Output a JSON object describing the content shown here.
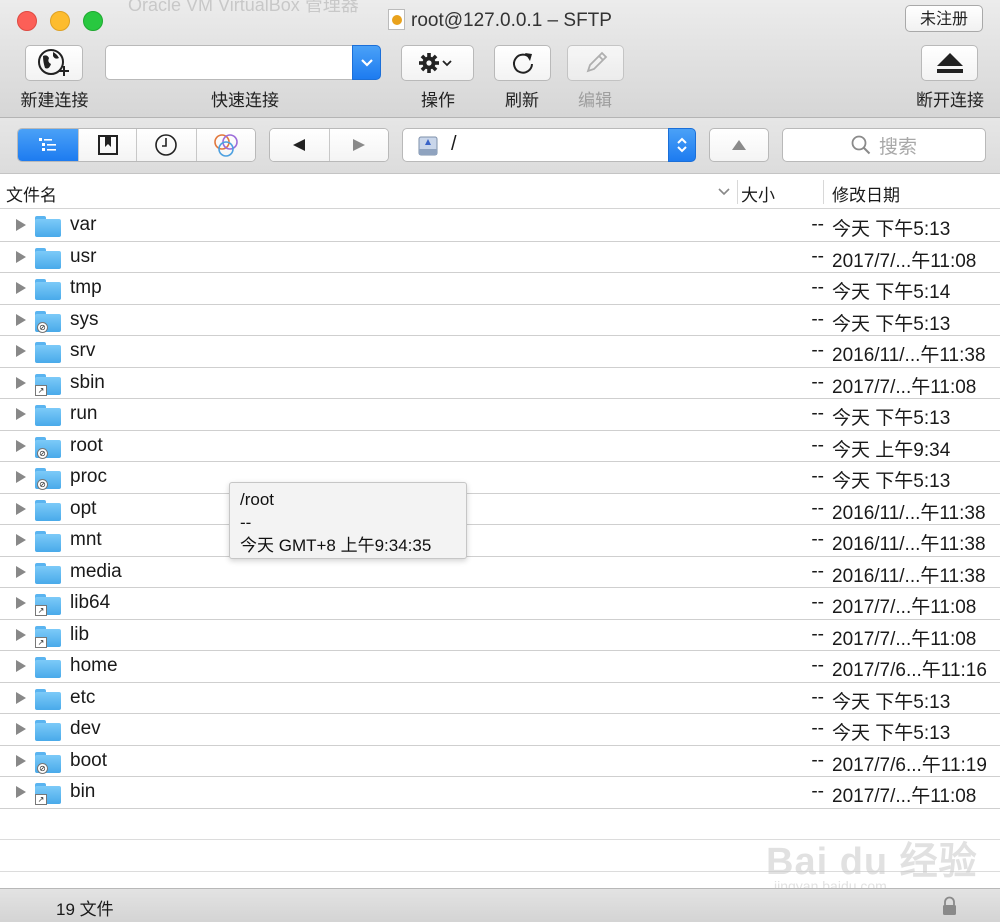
{
  "window": {
    "title": "root@127.0.0.1 – SFTP",
    "background_title": "Oracle VM VirtualBox 管理器",
    "register_label": "未注册"
  },
  "toolbar": {
    "new_connection_label": "新建连接",
    "quick_connect_label": "快速连接",
    "quick_connect_value": "",
    "action_label": "操作",
    "refresh_label": "刷新",
    "edit_label": "编辑",
    "disconnect_label": "断开连接"
  },
  "navbar": {
    "path": "/",
    "search_placeholder": "搜索"
  },
  "columns": {
    "name": "文件名",
    "size": "大小",
    "modified": "修改日期"
  },
  "files": [
    {
      "name": "var",
      "size": "--",
      "date": "今天 下午5:13",
      "badge": "none"
    },
    {
      "name": "usr",
      "size": "--",
      "date": "2017/7/...午11:08",
      "badge": "none"
    },
    {
      "name": "tmp",
      "size": "--",
      "date": "今天 下午5:14",
      "badge": "none"
    },
    {
      "name": "sys",
      "size": "--",
      "date": "今天 下午5:13",
      "badge": "noaccess"
    },
    {
      "name": "srv",
      "size": "--",
      "date": "2016/11/...午11:38",
      "badge": "none"
    },
    {
      "name": "sbin",
      "size": "--",
      "date": "2017/7/...午11:08",
      "badge": "alias"
    },
    {
      "name": "run",
      "size": "--",
      "date": "今天 下午5:13",
      "badge": "none"
    },
    {
      "name": "root",
      "size": "--",
      "date": "今天 上午9:34",
      "badge": "noaccess"
    },
    {
      "name": "proc",
      "size": "--",
      "date": "今天 下午5:13",
      "badge": "noaccess"
    },
    {
      "name": "opt",
      "size": "--",
      "date": "2016/11/...午11:38",
      "badge": "none"
    },
    {
      "name": "mnt",
      "size": "--",
      "date": "2016/11/...午11:38",
      "badge": "none"
    },
    {
      "name": "media",
      "size": "--",
      "date": "2016/11/...午11:38",
      "badge": "none"
    },
    {
      "name": "lib64",
      "size": "--",
      "date": "2017/7/...午11:08",
      "badge": "alias"
    },
    {
      "name": "lib",
      "size": "--",
      "date": "2017/7/...午11:08",
      "badge": "alias"
    },
    {
      "name": "home",
      "size": "--",
      "date": "2017/7/6...午11:16",
      "badge": "none"
    },
    {
      "name": "etc",
      "size": "--",
      "date": "今天 下午5:13",
      "badge": "none"
    },
    {
      "name": "dev",
      "size": "--",
      "date": "今天 下午5:13",
      "badge": "none"
    },
    {
      "name": "boot",
      "size": "--",
      "date": "2017/7/6...午11:19",
      "badge": "noaccess"
    },
    {
      "name": "bin",
      "size": "--",
      "date": "2017/7/...午11:08",
      "badge": "alias"
    }
  ],
  "tooltip": {
    "path": "/root",
    "size": "--",
    "date": "今天 GMT+8 上午9:34:35"
  },
  "status": {
    "count": "19 文件"
  },
  "watermark": {
    "brand": "Bai du 经验",
    "url": "jingyan.baidu.com"
  },
  "colors": {
    "accent_blue": "#1d7bf0",
    "folder_blue": "#5ab4f0"
  }
}
